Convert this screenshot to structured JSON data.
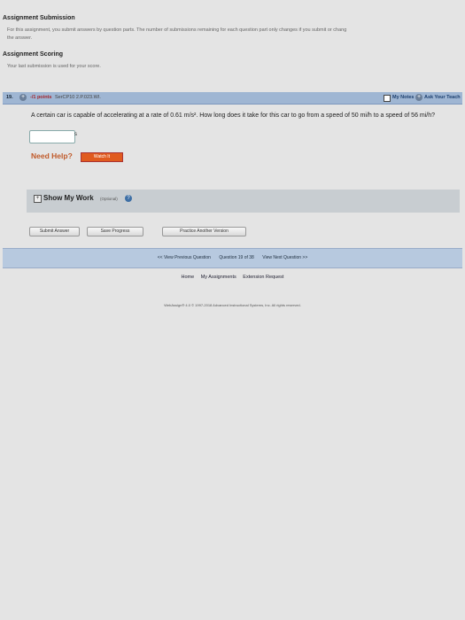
{
  "submission": {
    "title": "Assignment Submission",
    "text1": "For this assignment, you submit answers by question parts. The number of submissions remaining for each question part only changes if you submit or chang",
    "text2": "the answer."
  },
  "scoring": {
    "title": "Assignment Scoring",
    "text": "Your last submission is used for your score."
  },
  "question": {
    "number": "19.",
    "expand_icon": "+",
    "points": "-/1 points",
    "source": "SerCP10 2.P.023.WI.",
    "my_notes": "My Notes",
    "ask_teacher_icon": "+",
    "ask_teacher": "Ask Your Teach",
    "text": "A certain car is capable of accelerating at a rate of 0.61 m/s². How long does it take for this car to go from a speed of 50 mi/h to a speed of 56 mi/h?",
    "answer_value": "",
    "answer_unit": "s"
  },
  "help": {
    "label": "Need Help?",
    "watch": "Watch It"
  },
  "show_work": {
    "icon": "+",
    "label": "Show My Work",
    "optional": "(Optional)",
    "help_icon": "?"
  },
  "buttons": {
    "submit": "Submit Answer",
    "save": "Save Progress",
    "practice": "Practice Another Version"
  },
  "nav": {
    "prev": "<< View Previous Question",
    "position": "Question 19 of 38",
    "next": "View Next Question >>"
  },
  "footer": {
    "home": "Home",
    "my_assignments": "My Assignments",
    "extension": "Extension Request",
    "copyright": "WebAssign® 4.0 © 1997-2018 Advanced Instructional Systems, Inc. All rights reserved."
  }
}
